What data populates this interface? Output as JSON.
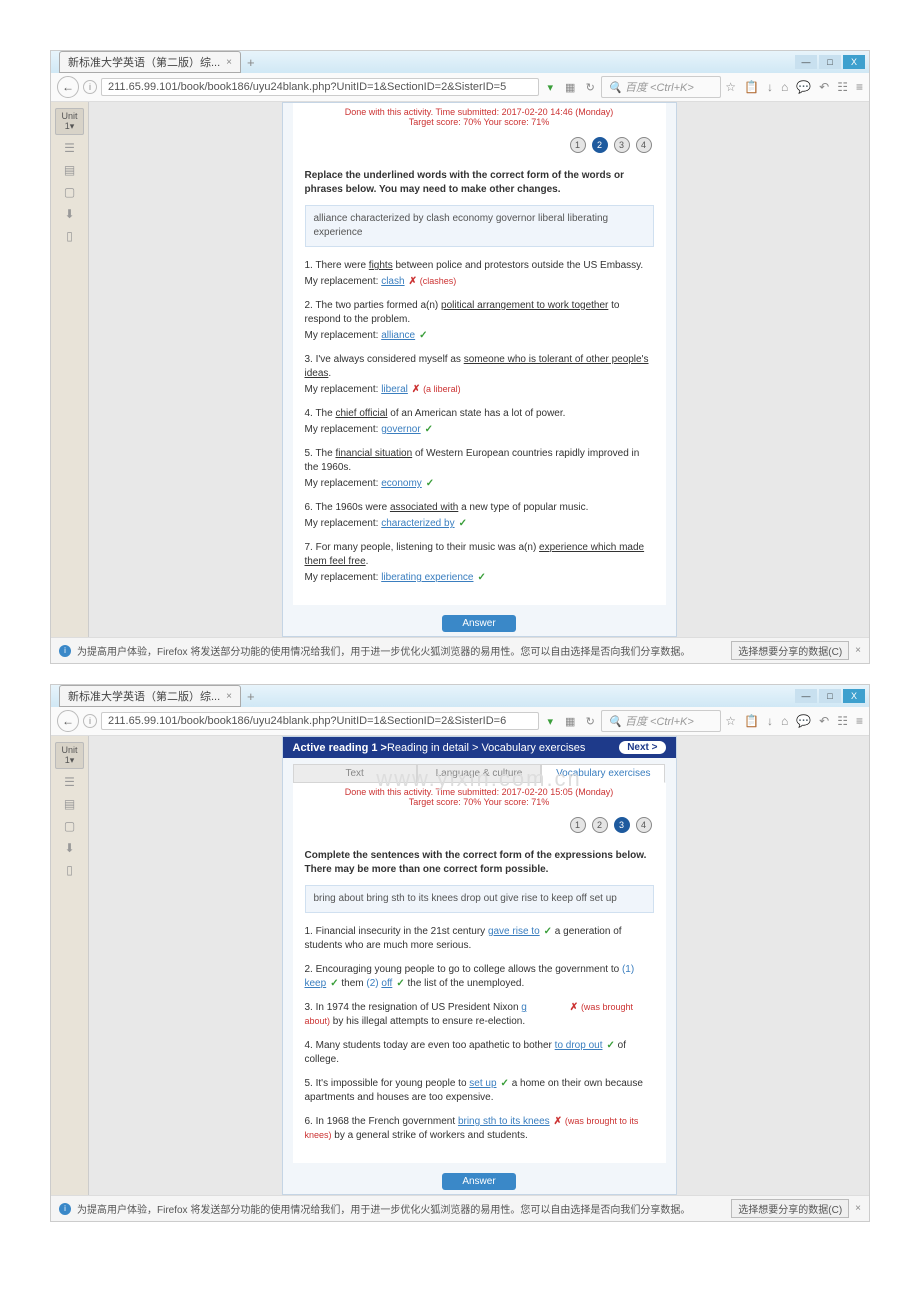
{
  "tab_title": "新标准大学英语（第二版）综...",
  "window1": {
    "url": "211.65.99.101/book/book186/uyu24blank.php?UnitID=1&SectionID=2&SisterID=5",
    "search_placeholder": "百度 <Ctrl+K>",
    "sidebar_unit": "Unit 1▾",
    "status_line1": "Done with this activity. Time submitted: 2017-02-20 14:46 (Monday)",
    "status_line2": "Target score: 70%   Your score: 71%",
    "pages": [
      "1",
      "2",
      "3",
      "4"
    ],
    "active_page": "2",
    "instructions": "Replace the underlined words with the correct form of the words or phrases below. You may need to make other changes.",
    "wordbox": "alliance   characterized by   clash   economy   governor   liberal   liberating experience",
    "questions": [
      {
        "pre": "1. There were ",
        "u": "fights",
        "post": " between police and protestors outside the US Embassy.",
        "ans": "clash",
        "mark": "bad",
        "hint": "(clashes)"
      },
      {
        "pre": "2. The two parties formed a(n) ",
        "u": "political arrangement to work together",
        "post": " to respond to the problem.",
        "ans": "alliance",
        "mark": "ok",
        "hint": ""
      },
      {
        "pre": "3. I've always considered myself as ",
        "u": "someone who is tolerant of other people's ideas",
        "post": ".",
        "ans": "liberal",
        "mark": "bad",
        "hint": "(a liberal)"
      },
      {
        "pre": "4. The ",
        "u": "chief official",
        "post": " of an American state has a lot of power.",
        "ans": "governor",
        "mark": "ok",
        "hint": ""
      },
      {
        "pre": "5. The ",
        "u": "financial situation",
        "post": " of Western European countries rapidly improved in the 1960s.",
        "ans": "economy",
        "mark": "ok",
        "hint": ""
      },
      {
        "pre": "6. The 1960s were ",
        "u": "associated with",
        "post": " a new type of popular music.",
        "ans": "characterized by",
        "mark": "ok",
        "hint": ""
      },
      {
        "pre": "7. For many people, listening to their music was a(n) ",
        "u": "experience which made them feel free",
        "post": ".",
        "ans": "liberating experience",
        "mark": "ok",
        "hint": ""
      }
    ],
    "answer_btn": "Answer",
    "replacement_label": "My replacement:"
  },
  "window2": {
    "url": "211.65.99.101/book/book186/uyu24blank.php?UnitID=1&SectionID=2&SisterID=6",
    "search_placeholder": "百度 <Ctrl+K>",
    "sidebar_unit": "Unit 1▾",
    "header_bold": "Active reading 1 >",
    "header_rest": " Reading in detail > Vocabulary exercises",
    "next_label": "Next >",
    "tabs": [
      "Text",
      "Language & culture",
      "Vocabulary exercises"
    ],
    "active_tab": 2,
    "status_line1": "Done with this activity. Time submitted: 2017-02-20 15:05 (Monday)",
    "status_line2": "Target score: 70%   Your score: 71%",
    "pages": [
      "1",
      "2",
      "3",
      "4"
    ],
    "active_page": "3",
    "instructions": "Complete the sentences with the correct form of the expressions below. There may be more than one correct form possible.",
    "wordbox": "bring about   bring sth to its knees   drop out   give rise to   keep off   set up",
    "q1_pre": "1. Financial insecurity in the 21st century ",
    "q1_ans": "gave rise to",
    "q1_post": " a generation of students who are much more serious.",
    "q2_pre": "2. Encouraging young people to go to college allows the government to ",
    "q2_n1": "(1)",
    "q2_a1": "keep",
    "q2_mid": " them ",
    "q2_n2": "(2)",
    "q2_a2": "off",
    "q2_post": " the list of the unemployed.",
    "q3_pre": "3. In 1974 the resignation of US President Nixon ",
    "q3_ans": "g",
    "q3_hint": "(was brought about)",
    "q3_post": " by his illegal attempts to ensure re-election.",
    "q4_pre": "4. Many students today are even too apathetic to bother ",
    "q4_ans": "to drop out",
    "q4_post": " of college.",
    "q5_pre": "5. It's impossible for young people to ",
    "q5_ans": "set up",
    "q5_post": " a home on their own because apartments and houses are too expensive.",
    "q6_pre": "6. In 1968 the French government ",
    "q6_ans": "bring sth to its knees",
    "q6_hint": "(was brought to its knees)",
    "q6_post": " by a general strike of workers and students.",
    "answer_btn": "Answer"
  },
  "bottom_text": "为提高用户体验，Firefox 将发送部分功能的使用情况给我们，用于进一步优化火狐浏览器的易用性。您可以自由选择是否向我们分享数据。",
  "share_btn": "选择想要分享的数据(C)",
  "watermark": "www.yixin.com.cn"
}
